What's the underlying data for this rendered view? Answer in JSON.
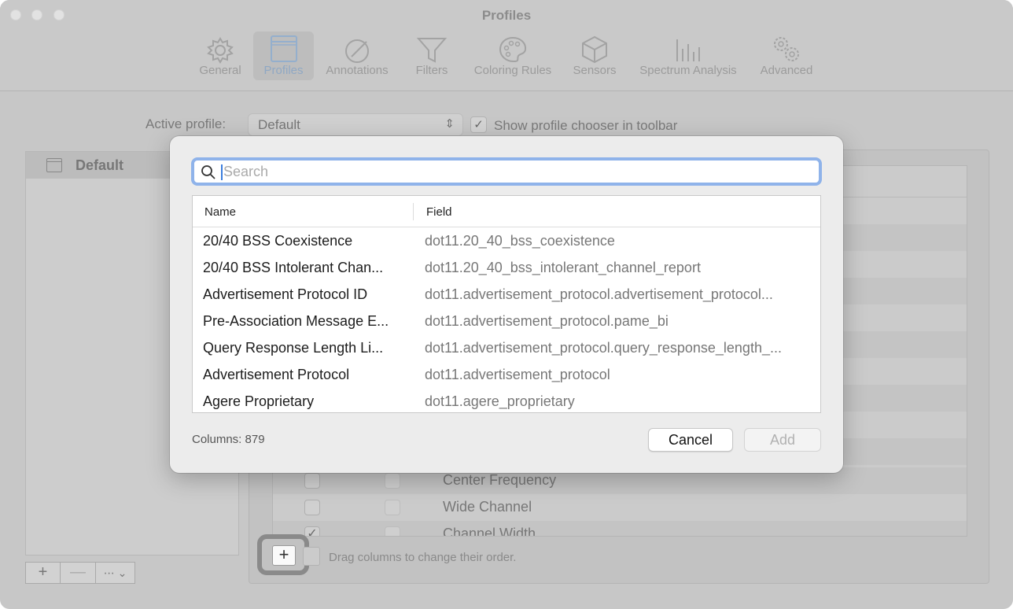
{
  "window": {
    "title": "Profiles"
  },
  "toolbar": {
    "items": [
      {
        "label": "General",
        "icon": "gear-icon"
      },
      {
        "label": "Profiles",
        "icon": "window-icon",
        "selected": true
      },
      {
        "label": "Annotations",
        "icon": "pencil-circle-icon"
      },
      {
        "label": "Filters",
        "icon": "funnel-icon"
      },
      {
        "label": "Coloring Rules",
        "icon": "palette-icon"
      },
      {
        "label": "Sensors",
        "icon": "cube-icon"
      },
      {
        "label": "Spectrum Analysis",
        "icon": "spectrum-bars-icon"
      },
      {
        "label": "Advanced",
        "icon": "gears-icon"
      }
    ]
  },
  "profile_bar": {
    "active_label": "Active profile:",
    "selected_profile": "Default",
    "show_chooser_label": "Show profile chooser in toolbar",
    "show_chooser_checked": true
  },
  "profiles_list": {
    "items": [
      {
        "name": "Default",
        "selected": true
      }
    ],
    "add_label": "+",
    "remove_label": "—",
    "more_label": "⋯ ⌄"
  },
  "columns_table": {
    "rows": [
      {
        "title": "Center Frequency",
        "visible": false
      },
      {
        "title": "Wide Channel",
        "visible": false
      },
      {
        "title": "Channel Width",
        "visible": true
      }
    ],
    "add_button_label": "+",
    "drag_hint": "Drag columns to change their order."
  },
  "dialog": {
    "search_placeholder": "Search",
    "search_value": "",
    "headers": {
      "name": "Name",
      "field": "Field"
    },
    "rows": [
      {
        "name": "20/40 BSS Coexistence",
        "field": "dot11.20_40_bss_coexistence"
      },
      {
        "name": "20/40 BSS Intolerant Chan...",
        "field": "dot11.20_40_bss_intolerant_channel_report"
      },
      {
        "name": "Advertisement Protocol ID",
        "field": "dot11.advertisement_protocol.advertisement_protocol..."
      },
      {
        "name": "Pre-Association Message E...",
        "field": "dot11.advertisement_protocol.pame_bi"
      },
      {
        "name": "Query Response Length Li...",
        "field": "dot11.advertisement_protocol.query_response_length_..."
      },
      {
        "name": "Advertisement Protocol",
        "field": "dot11.advertisement_protocol"
      },
      {
        "name": "Agere Proprietary",
        "field": "dot11.agere_proprietary"
      }
    ],
    "columns_count": "Columns: 879",
    "cancel_label": "Cancel",
    "add_label": "Add",
    "add_enabled": false
  },
  "colors": {
    "accent": "#8fb3ea",
    "window_bg": "#c7c7c7",
    "dialog_bg": "#ececec"
  }
}
